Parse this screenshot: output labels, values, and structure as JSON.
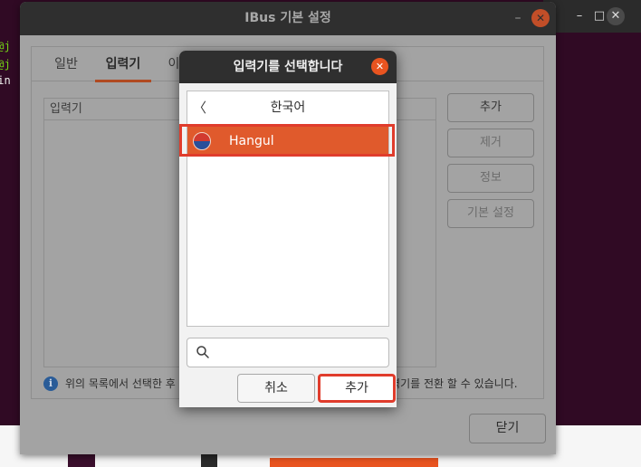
{
  "terminal": {
    "lines": [
      "n@j",
      "n@j",
      "hin"
    ]
  },
  "background_window": {
    "minimize_icon": "minimize-icon",
    "maximize_icon": "maximize-icon",
    "close_icon": "close-icon",
    "minimize_glyph": "–",
    "maximize_glyph": "□",
    "close_glyph": "✕"
  },
  "ibus_window": {
    "title": "IBus 기본 설정",
    "minimize_glyph": "–",
    "close_glyph": "✕",
    "tabs": [
      {
        "label": "일반",
        "active": false
      },
      {
        "label": "입력기",
        "active": true
      },
      {
        "label": "이",
        "active": false
      }
    ],
    "list_header": "입력기",
    "buttons": {
      "add": "추가",
      "remove": "제거",
      "about": "정보",
      "preferences": "기본 설정"
    },
    "info_glyph": "i",
    "info_text_left": "위의 목록에서 선택한 후 키",
    "info_text_right": "입력기를 전환 할 수 있습니다.",
    "close_button": "닫기"
  },
  "dialog": {
    "title": "입력기를 선택합니다",
    "close_glyph": "✕",
    "back_glyph": "〈",
    "language": "한국어",
    "items": [
      {
        "label": "Hangul",
        "selected": true
      }
    ],
    "search": {
      "value": "",
      "placeholder": ""
    },
    "cancel_button": "취소",
    "add_button": "추가"
  },
  "colors": {
    "accent": "#e95420",
    "selection": "#e05a2c",
    "annotation": "#e03c2c",
    "terminal_bg": "#300a24"
  }
}
